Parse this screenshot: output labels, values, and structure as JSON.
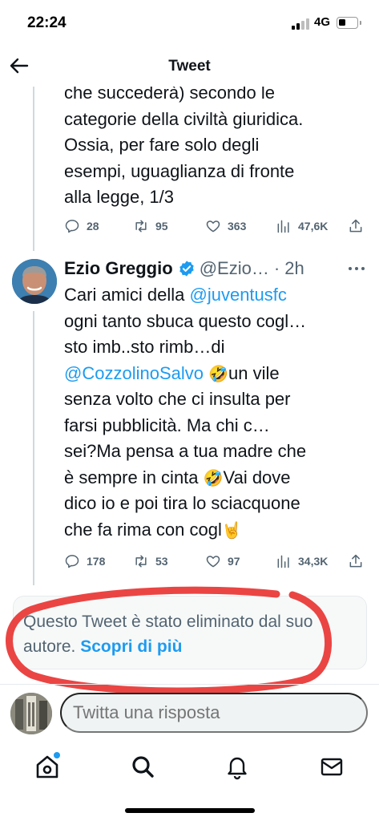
{
  "status_bar": {
    "time": "22:24",
    "network": "4G"
  },
  "header": {
    "title": "Tweet"
  },
  "previous_tweet": {
    "lines": [
      "che succederà) secondo le",
      "categorie della civiltà giuridica.",
      "Ossia, per fare solo degli",
      "esempi, uguaglianza di fronte",
      "alla legge, 1/3"
    ],
    "replies": "28",
    "retweets": "95",
    "likes": "363",
    "views": "47,6K"
  },
  "main_tweet": {
    "author_name": "Ezio Greggio",
    "handle": "@Ezio…",
    "time": "· 2h",
    "text": {
      "l1_pre": "Cari amici della ",
      "l1_mention": "@juventusfc",
      "l2": "ogni tanto sbuca questo cogl…",
      "l3": "sto imb..sto rimb…di",
      "l4_mention": "@CozzolinoSalvo",
      "l4_emoji": "🤣",
      "l4_post": "un vile",
      "l5": "senza volto che ci insulta per",
      "l6": "farsi pubblicità. Ma chi c…",
      "l7": "sei?Ma pensa a tua madre che",
      "l8_pre": "è sempre in cinta ",
      "l8_emoji": "🤣",
      "l8_post": "Vai dove",
      "l9": "dico io e poi tira lo sciacquone",
      "l10_pre": "che fa rima con cogl",
      "l10_emoji": "🤘"
    },
    "replies": "178",
    "retweets": "53",
    "likes": "97",
    "views": "34,3K"
  },
  "deleted_notice": {
    "text": "Questo Tweet è stato eliminato dal suo autore.",
    "link": "Scopri di più"
  },
  "reply_bar": {
    "placeholder": "Twitta una risposta"
  },
  "colors": {
    "accent": "#1d9bf0",
    "secondary_text": "#536471",
    "annotation": "#e8312f"
  }
}
